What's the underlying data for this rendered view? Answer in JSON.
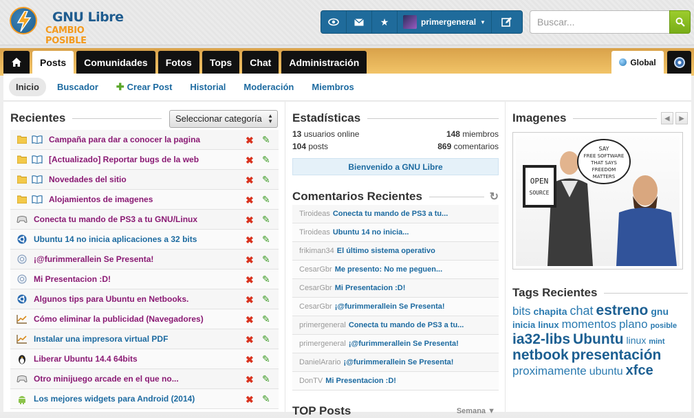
{
  "brand": {
    "title": "GNU Libre",
    "subtitle": "CAMBIO POSIBLE"
  },
  "userbar": {
    "username": "primergeneral",
    "buttons": [
      "eye-icon",
      "envelope-icon",
      "star-icon"
    ],
    "edit_icon": "edit-icon"
  },
  "search": {
    "placeholder": "Buscar..."
  },
  "nav": {
    "tabs": [
      "Posts",
      "Comunidades",
      "Fotos",
      "Tops",
      "Chat",
      "Administración"
    ],
    "active": "Posts",
    "global_label": "Global"
  },
  "subnav": {
    "items": [
      "Inicio",
      "Buscador",
      "Crear Post",
      "Historial",
      "Moderación",
      "Miembros"
    ],
    "active": "Inicio"
  },
  "recientes": {
    "title": "Recientes",
    "select_value": "Seleccionar categoría",
    "posts": [
      {
        "title": "Campaña para dar a conocer la pagina",
        "icon": "folder-icon",
        "icon2": "book-icon",
        "color": "purple"
      },
      {
        "title": "[Actualizado] Reportar bugs de la web",
        "icon": "folder-icon",
        "icon2": "book-icon",
        "color": "purple"
      },
      {
        "title": "Novedades del sitio",
        "icon": "folder-icon",
        "icon2": "book-icon",
        "color": "purple"
      },
      {
        "title": "Alojamientos de imagenes",
        "icon": "folder-icon",
        "icon2": "book-icon",
        "color": "purple"
      },
      {
        "title": "Conecta tu mando de PS3 a tu GNU/Linux",
        "icon": "gamepad-icon",
        "color": "purple"
      },
      {
        "title": "Ubuntu 14 no inicia aplicaciones a 32 bits",
        "icon": "ubuntu-icon",
        "color": "blue"
      },
      {
        "title": "¡@furimmerallein Se Presenta!",
        "icon": "support-icon",
        "color": "purple"
      },
      {
        "title": "Mi Presentacion :D!",
        "icon": "support-icon",
        "color": "purple"
      },
      {
        "title": "Algunos tips para Ubuntu en Netbooks.",
        "icon": "ubuntu-icon",
        "color": "purple"
      },
      {
        "title": "Cómo eliminar la publicidad (Navegadores)",
        "icon": "chart-icon",
        "color": "purple"
      },
      {
        "title": "Instalar una impresora virtual PDF",
        "icon": "chart-icon",
        "color": "blue"
      },
      {
        "title": "Liberar Ubuntu 14.4 64bits",
        "icon": "tux-icon",
        "color": "purple"
      },
      {
        "title": "Otro minijuego arcade en el que no...",
        "icon": "gamepad-icon",
        "color": "purple"
      },
      {
        "title": "Los mejores widgets para Android (2014)",
        "icon": "android-icon",
        "color": "blue"
      }
    ]
  },
  "stats": {
    "title": "Estadísticas",
    "users_online": "13",
    "users_online_label": "usuarios online",
    "members": "148",
    "members_label": "miembros",
    "posts": "104",
    "posts_label": "posts",
    "comments": "869",
    "comments_label": "comentarios",
    "welcome": "Bienvenido a GNU Libre"
  },
  "comments": {
    "title": "Comentarios Recientes",
    "items": [
      {
        "user": "Tiroideas",
        "post": "Conecta tu mando de PS3 a tu..."
      },
      {
        "user": "Tiroideas",
        "post": "Ubuntu 14 no inicia..."
      },
      {
        "user": "frikiman34",
        "post": "El último sistema operativo"
      },
      {
        "user": "CesarGbr",
        "post": "Me presento: No me peguen..."
      },
      {
        "user": "CesarGbr",
        "post": "Mi Presentacion :D!"
      },
      {
        "user": "CesarGbr",
        "post": "¡@furimmerallein Se Presenta!"
      },
      {
        "user": "primergeneral",
        "post": "Conecta tu mando de PS3 a tu..."
      },
      {
        "user": "primergeneral",
        "post": "¡@furimmerallein Se Presenta!"
      },
      {
        "user": "DanielArario",
        "post": "¡@furimmerallein Se Presenta!"
      },
      {
        "user": "DonTV",
        "post": "Mi Presentacion :D!"
      }
    ]
  },
  "top_posts": {
    "title": "TOP Posts",
    "period": "Semana"
  },
  "imagenes": {
    "title": "Imagenes",
    "sign_left": "OPEN SOURCE",
    "bubble": "SAY FREE SOFTWARE THAT SAYS FREEDOM MATTERS"
  },
  "tags": {
    "title": "Tags Recientes",
    "items": [
      {
        "t": "bits",
        "s": 17,
        "b": false
      },
      {
        "t": "chapita",
        "s": 14,
        "b": true
      },
      {
        "t": "chat",
        "s": 18,
        "b": false
      },
      {
        "t": "estreno",
        "s": 21,
        "b": true
      },
      {
        "t": "gnu",
        "s": 14,
        "b": true
      },
      {
        "t": "inicia",
        "s": 13,
        "b": true
      },
      {
        "t": "linux",
        "s": 13,
        "b": true
      },
      {
        "t": "momentos",
        "s": 17,
        "b": false
      },
      {
        "t": "plano",
        "s": 17,
        "b": false
      },
      {
        "t": "posible",
        "s": 11,
        "b": true
      },
      {
        "t": "ia32-libs",
        "s": 21,
        "b": true
      },
      {
        "t": "Ubuntu",
        "s": 21,
        "b": true
      },
      {
        "t": "linux",
        "s": 14,
        "b": false
      },
      {
        "t": "mint",
        "s": 11,
        "b": true
      },
      {
        "t": "netbook",
        "s": 21,
        "b": true
      },
      {
        "t": "presentación",
        "s": 21,
        "b": true
      },
      {
        "t": "proximamente",
        "s": 17,
        "b": false
      },
      {
        "t": "ubuntu",
        "s": 16,
        "b": false
      },
      {
        "t": "xfce",
        "s": 20,
        "b": true
      }
    ]
  }
}
